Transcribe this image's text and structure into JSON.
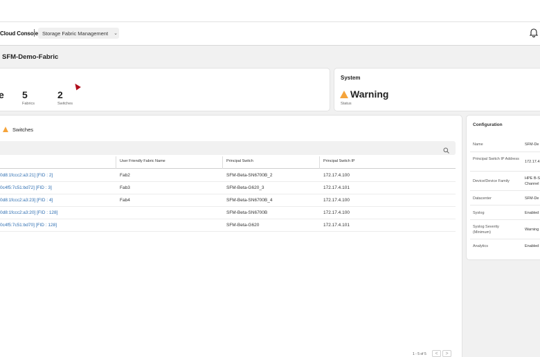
{
  "header": {
    "brand": "Cloud Console",
    "app_name": "Storage Fabric Management",
    "chevron": "⌄",
    "bell_icon": "bell-icon"
  },
  "page": {
    "title": "SFM-Demo-Fabric"
  },
  "stats": {
    "partial_letter": "e",
    "fabrics_value": "5",
    "fabrics_label": "Fabrics",
    "switches_value": "2",
    "switches_label": "Switches"
  },
  "system": {
    "label": "System",
    "status_value": "Warning",
    "status_label": "Status",
    "warning_color": "#f5a43b"
  },
  "switches_panel": {
    "title": "Switches",
    "search_icon": "search-icon",
    "columns": [
      "User Friendly Fabric Name",
      "Principal Switch",
      "Principal Switch IP"
    ],
    "rows": [
      {
        "id": "0d8:1fccc2:a3:21] [FID : 2]",
        "name": "Fab2",
        "switch": "SFM-Beta-SN6700B_2",
        "ip": "172.17.4.100"
      },
      {
        "id": "0c4f5:7c51:bd72] [FID : 3]",
        "name": "Fab3",
        "switch": "SFM-Beta-G620_3",
        "ip": "172.17.4.101"
      },
      {
        "id": "0d8:1fccc2:a3:23] [FID : 4]",
        "name": "Fab4",
        "switch": "SFM-Beta-SN6700B_4",
        "ip": "172.17.4.100"
      },
      {
        "id": "0d8:1fccc2:a3:20] [FID : 128]",
        "name": "",
        "switch": "SFM-Beta-SN6700B",
        "ip": "172.17.4.100"
      },
      {
        "id": "0c4f5:7c51:bd70] [FID : 128]",
        "name": "",
        "switch": "SFM-Beta-G620",
        "ip": "172.17.4.101"
      }
    ],
    "pagination": {
      "text": "1 - 5 of 5",
      "prev": "<",
      "next": ">"
    }
  },
  "configuration": {
    "title": "Configuration",
    "items": [
      {
        "key": "Name",
        "value": "SFM-De"
      },
      {
        "key": "Principal Switch IP Address",
        "value": "172.17.4"
      },
      {
        "key": "Device/Device Family",
        "value": "HPE B-S\nChannel"
      },
      {
        "key": "Datacenter",
        "value": "SFM-De"
      },
      {
        "key": "Syslog",
        "value": "Enabled"
      },
      {
        "key": "Syslog Severity (Minimum)",
        "value": "Warning"
      },
      {
        "key": "Analytics",
        "value": "Enabled"
      }
    ]
  }
}
